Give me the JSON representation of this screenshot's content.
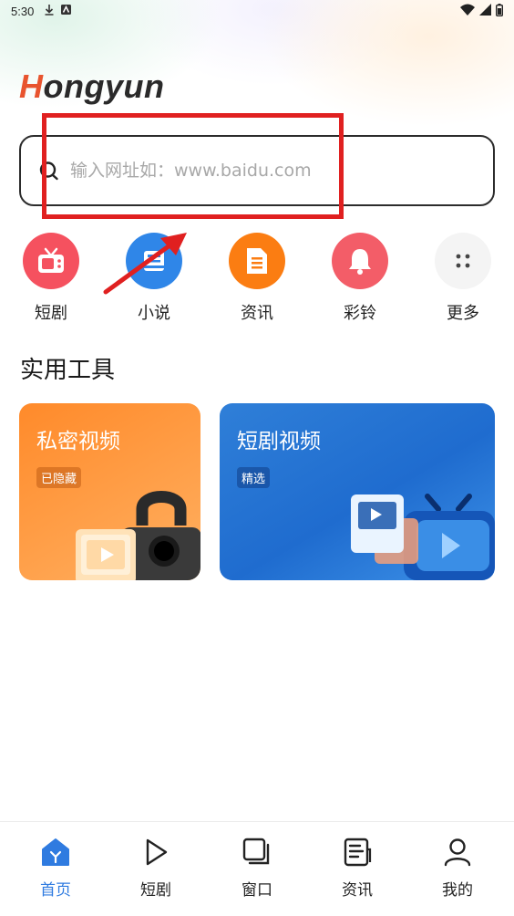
{
  "status_bar": {
    "time": "5:30"
  },
  "app": {
    "logo_first_letter": "H",
    "logo_rest": "ongyun"
  },
  "search": {
    "placeholder": "输入网址如：www.baidu.com",
    "value": ""
  },
  "quick_links": [
    {
      "label": "短剧",
      "icon": "tv-icon",
      "color": "#f5515f"
    },
    {
      "label": "小说",
      "icon": "book-icon",
      "color": "#2f86e8"
    },
    {
      "label": "资讯",
      "icon": "document-icon",
      "color": "#fb7d12"
    },
    {
      "label": "彩铃",
      "icon": "bell-icon",
      "color": "#f35d68"
    },
    {
      "label": "更多",
      "icon": "more-dots-icon",
      "color": "#f4f4f4"
    }
  ],
  "tools": {
    "title": "实用工具",
    "cards": [
      {
        "title": "私密视频",
        "badge": "已隐藏"
      },
      {
        "title": "短剧视频",
        "badge": "精选"
      }
    ]
  },
  "tab_bar": {
    "active": "首页",
    "tabs": [
      {
        "label": "首页",
        "icon": "home-icon"
      },
      {
        "label": "短剧",
        "icon": "play-icon"
      },
      {
        "label": "窗口",
        "icon": "windows-icon"
      },
      {
        "label": "资讯",
        "icon": "news-icon"
      },
      {
        "label": "我的",
        "icon": "user-icon"
      }
    ]
  },
  "colors": {
    "accent": "#2f7be0",
    "logo_accent": "#e8542e",
    "annotation": "#e02020"
  }
}
